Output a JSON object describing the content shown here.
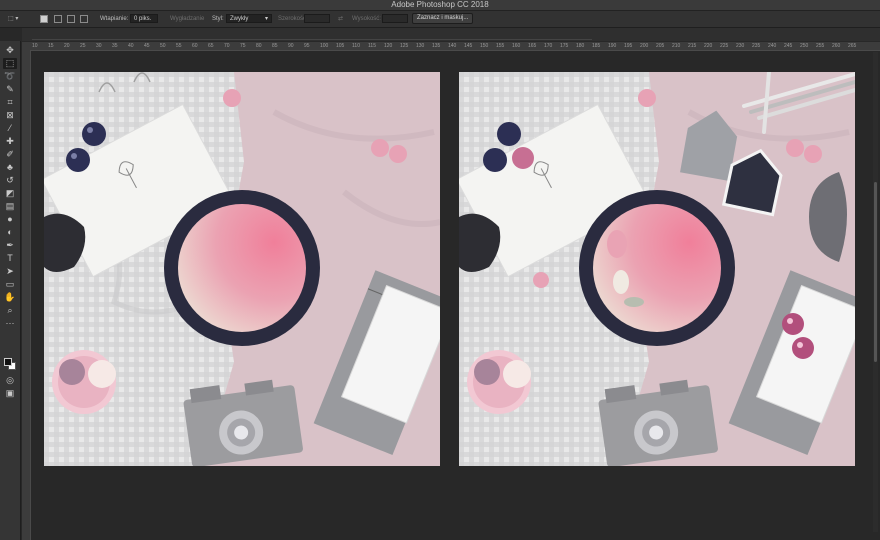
{
  "window": {
    "title": "Adobe Photoshop CC 2018"
  },
  "options_bar": {
    "feather_label": "Wtapianie:",
    "feather_value": "0 piks.",
    "antialias_label": "Wygładzanie",
    "style_label": "Styl:",
    "style_value": "Zwykły",
    "width_label": "Szerokość:",
    "height_label": "Wysokość:",
    "select_mask_button": "Zaznacz i maskuj..."
  },
  "ruler": {
    "ticks": [
      "10",
      "15",
      "20",
      "25",
      "30",
      "35",
      "40",
      "45",
      "50",
      "55",
      "60",
      "65",
      "70",
      "75",
      "80",
      "85",
      "90",
      "95",
      "100",
      "105",
      "110",
      "115",
      "120",
      "125",
      "130",
      "135",
      "140",
      "145",
      "150",
      "155",
      "160",
      "165",
      "170",
      "175",
      "180",
      "185",
      "190",
      "195",
      "200",
      "205",
      "210",
      "215",
      "220",
      "225",
      "230",
      "235",
      "240",
      "245",
      "250",
      "255",
      "260",
      "265",
      "270"
    ]
  },
  "tools": [
    {
      "name": "move-tool-icon",
      "glyph": "✥"
    },
    {
      "name": "marquee-tool-icon",
      "glyph": "⬚"
    },
    {
      "name": "lasso-tool-icon",
      "glyph": "➰"
    },
    {
      "name": "quick-select-tool-icon",
      "glyph": "✎"
    },
    {
      "name": "crop-tool-icon",
      "glyph": "⌗"
    },
    {
      "name": "frame-tool-icon",
      "glyph": "⊠"
    },
    {
      "name": "eyedropper-tool-icon",
      "glyph": "⁄"
    },
    {
      "name": "healing-tool-icon",
      "glyph": "✚"
    },
    {
      "name": "brush-tool-icon",
      "glyph": "✐"
    },
    {
      "name": "stamp-tool-icon",
      "glyph": "♣"
    },
    {
      "name": "history-brush-tool-icon",
      "glyph": "↺"
    },
    {
      "name": "eraser-tool-icon",
      "glyph": "◩"
    },
    {
      "name": "gradient-tool-icon",
      "glyph": "▤"
    },
    {
      "name": "blur-tool-icon",
      "glyph": "●"
    },
    {
      "name": "dodge-tool-icon",
      "glyph": "◐"
    },
    {
      "name": "pen-tool-icon",
      "glyph": "✒"
    },
    {
      "name": "type-tool-icon",
      "glyph": "T"
    },
    {
      "name": "path-select-tool-icon",
      "glyph": "➤"
    },
    {
      "name": "shape-tool-icon",
      "glyph": "▭"
    },
    {
      "name": "hand-tool-icon",
      "glyph": "✋"
    },
    {
      "name": "zoom-tool-icon",
      "glyph": "⌕"
    },
    {
      "name": "more-tools-icon",
      "glyph": "···"
    }
  ],
  "documents": [
    {
      "name": "original-photo"
    },
    {
      "name": "edited-photo"
    }
  ]
}
